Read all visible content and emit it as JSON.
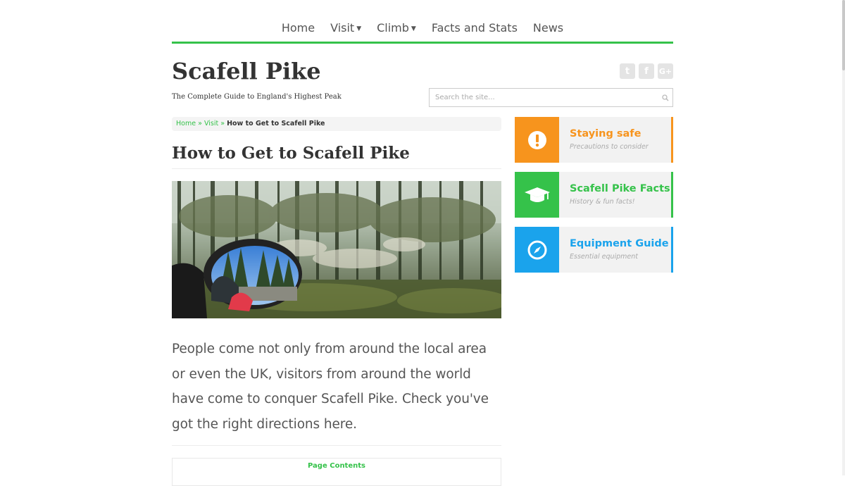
{
  "nav": {
    "items": [
      {
        "label": "Home",
        "dropdown": false
      },
      {
        "label": "Visit",
        "dropdown": true
      },
      {
        "label": "Climb",
        "dropdown": true
      },
      {
        "label": "Facts and Stats",
        "dropdown": false
      },
      {
        "label": "News",
        "dropdown": false
      }
    ]
  },
  "header": {
    "title": "Scafell Pike",
    "tagline": "The Complete Guide to England's Highest Peak"
  },
  "social": {
    "twitter_glyph": "t",
    "facebook_glyph": "f",
    "googleplus_glyph": "G+"
  },
  "search": {
    "placeholder": "Search the site..."
  },
  "breadcrumb": {
    "home": "Home",
    "sep": "»",
    "visit": "Visit",
    "current": "How to Get to Scafell Pike"
  },
  "main": {
    "page_title": "How to Get to Scafell Pike",
    "intro": "People come not only from around the local area or even the UK, visitors from around the world have come to conquer Scafell Pike. Check you've got the right directions here.",
    "contents_heading": "Page Contents"
  },
  "sidebar": {
    "cards": [
      {
        "title": "Staying safe",
        "subtitle": "Precautions to consider",
        "color": "#f7941d",
        "icon": "exclamation-icon"
      },
      {
        "title": "Scafell Pike Facts",
        "subtitle": "History & fun facts!",
        "color": "#35c24a",
        "icon": "graduation-cap-icon"
      },
      {
        "title": "Equipment Guide",
        "subtitle": "Essential equipment",
        "color": "#1aa3ec",
        "icon": "compass-icon"
      }
    ]
  },
  "colors": {
    "accent": "#35c24a",
    "orange": "#f7941d",
    "blue": "#1aa3ec"
  }
}
